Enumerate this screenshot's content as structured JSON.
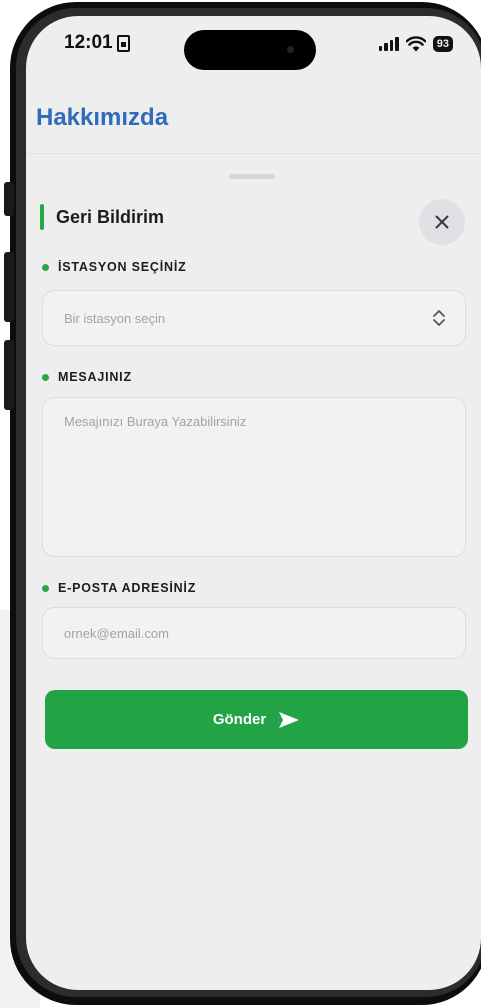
{
  "status_bar": {
    "time": "12:01",
    "battery": "93"
  },
  "header": {
    "title": "Hakkımızda"
  },
  "sheet": {
    "title": "Geri Bildirim",
    "station": {
      "label": "İSTASYON SEÇİNİZ",
      "placeholder": "Bir istasyon seçin"
    },
    "message": {
      "label": "MESAJINIZ",
      "placeholder": "Mesajınızı Buraya Yazabilirsiniz"
    },
    "email": {
      "label": "E-POSTA ADRESİNİZ",
      "placeholder": "ornek@email.com"
    },
    "submit_label": "Gönder"
  },
  "colors": {
    "accent_green": "#22a346",
    "title_blue": "#2f6bbd",
    "sheet_background": "#eeeeee"
  },
  "icons": {
    "close": "close-icon",
    "chevron": "chevron-up-down-icon",
    "send": "send-icon"
  }
}
